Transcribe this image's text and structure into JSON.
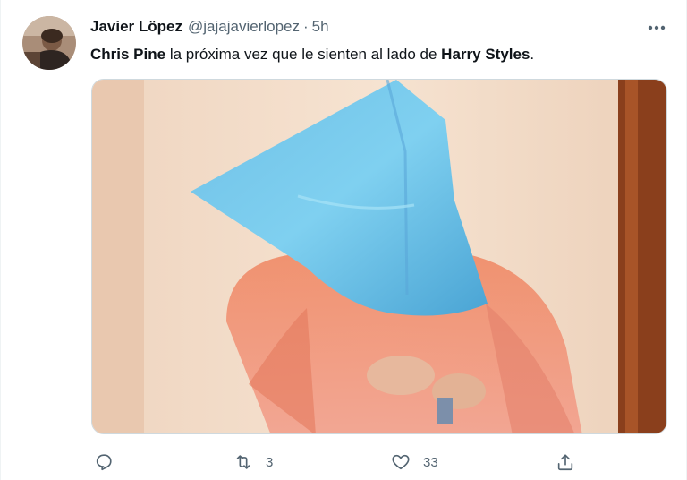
{
  "tweet": {
    "author": {
      "name": "Javier Löpez",
      "handle": "@jajajavierlopez",
      "separator": "·",
      "time": "5h",
      "avatar_icon": "avatar-photo"
    },
    "more_icon": "more-horizontal-icon",
    "text": {
      "bold_1": "Chris Pine",
      "middle": " la próxima vez que le sienten al lado de ",
      "bold_2": "Harry Styles",
      "end": "."
    },
    "media": {
      "kind": "photo"
    },
    "actions": {
      "reply": {
        "icon": "reply-icon",
        "count": ""
      },
      "retweet": {
        "icon": "retweet-icon",
        "count": "3"
      },
      "like": {
        "icon": "heart-icon",
        "count": "33"
      },
      "share": {
        "icon": "share-icon",
        "count": ""
      }
    },
    "colors": {
      "text": "#0f1419",
      "secondary": "#536471",
      "border": "#cfd9de"
    }
  }
}
